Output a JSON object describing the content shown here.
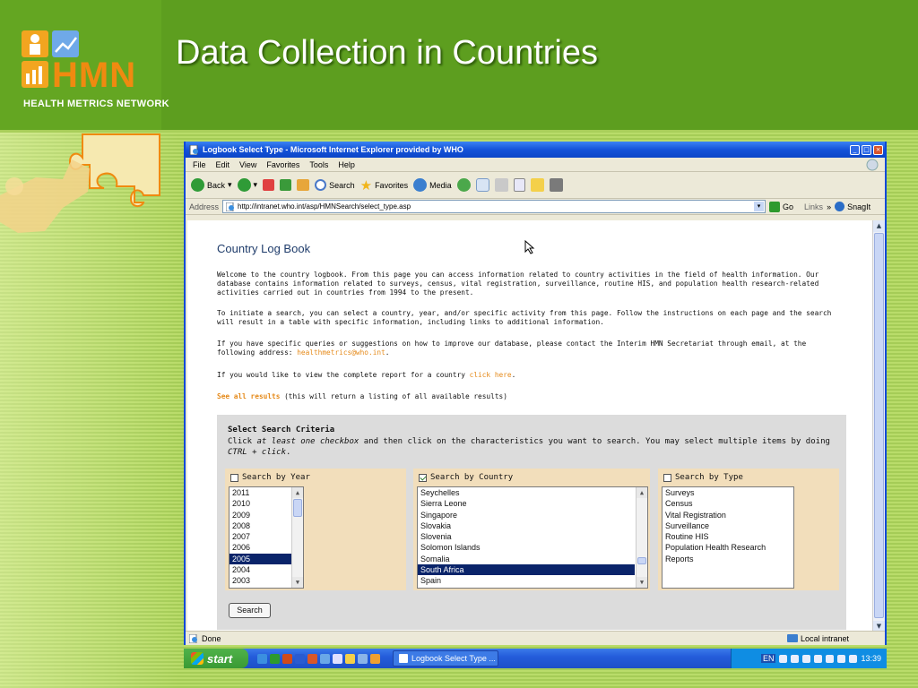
{
  "slide": {
    "title": "Data Collection in Countries",
    "logo_text": "HMN",
    "logo_subtitle": "HEALTH METRICS NETWORK",
    "colors": {
      "header": "#5d9e1f",
      "accent": "#f08a10",
      "background": "#a9cf5a"
    }
  },
  "browser": {
    "window_title": "Logbook Select Type - Microsoft Internet Explorer provided by WHO",
    "menu": [
      "File",
      "Edit",
      "View",
      "Favorites",
      "Tools",
      "Help"
    ],
    "toolbar": {
      "back": "Back",
      "search": "Search",
      "favorites": "Favorites",
      "media": "Media"
    },
    "address_label": "Address",
    "address_url": "http://intranet.who.int/asp/HMNSearch/select_type.asp",
    "go_label": "Go",
    "links_label": "Links",
    "snagit_label": "SnagIt",
    "status_text": "Done",
    "status_zone": "Local intranet"
  },
  "page": {
    "heading": "Country Log Book",
    "intro": "Welcome to the country logbook. From this page you can access information related to country activities in the field of health information. Our database contains information related to surveys, census, vital registration, surveillance, routine HIS, and population health research-related activities carried out in countries from 1994 to the present.",
    "instructions": "To initiate a search, you can select a country, year, and/or specific activity from this page. Follow the instructions on each page and the search will result in a table with specific information, including links to additional information.",
    "contact_prefix": "If you have specific queries or suggestions on how to improve our database, please contact the Interim HMN Secretariat through email, at the following address: ",
    "contact_email": "healthmetrics@who.int",
    "contact_suffix": ".",
    "report_prefix": "If you would like to view the complete report for a country ",
    "report_link": "click here",
    "report_suffix": ".",
    "see_all_link": "See all results",
    "see_all_suffix": " (this will return a listing of all available results)"
  },
  "criteria": {
    "title": "Select Search Criteria",
    "desc_1": "Click ",
    "desc_em": "at least one checkbox",
    "desc_2": " and then click on the characteristics you want to search. You may select multiple items by doing ",
    "desc_em2": "CTRL + click",
    "desc_3": ".",
    "year": {
      "label": "Search by Year",
      "checked": false,
      "items": [
        "2011",
        "2010",
        "2009",
        "2008",
        "2007",
        "2006",
        "2005",
        "2004",
        "2003"
      ],
      "selected": "2005"
    },
    "country": {
      "label": "Search by Country",
      "checked": true,
      "items": [
        "Seychelles",
        "Sierra Leone",
        "Singapore",
        "Slovakia",
        "Slovenia",
        "Solomon Islands",
        "Somalia",
        "South Africa",
        "Spain"
      ],
      "selected": "South Africa"
    },
    "type": {
      "label": "Search by Type",
      "checked": false,
      "items": [
        "Surveys",
        "Census",
        "Vital Registration",
        "Surveillance",
        "Routine HIS",
        "Population Health Research",
        "Reports"
      ],
      "selected": ""
    },
    "search_button": "Search"
  },
  "taskbar": {
    "start_label": "start",
    "task_label": "Logbook Select Type ...",
    "language": "EN",
    "clock": "13:39"
  }
}
